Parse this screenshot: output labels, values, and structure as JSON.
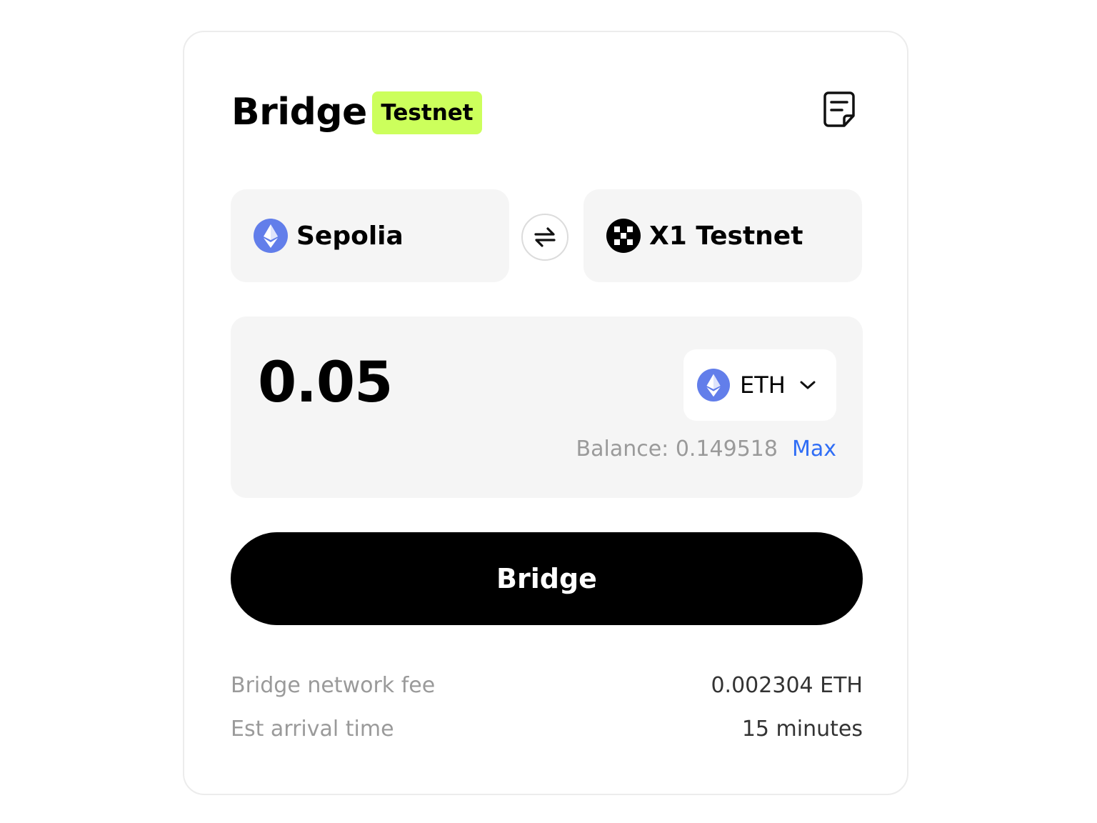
{
  "header": {
    "title": "Bridge",
    "badge": "Testnet",
    "badge_color": "#ccff5c"
  },
  "route": {
    "from": {
      "name": "Sepolia",
      "icon": "ethereum-icon"
    },
    "to": {
      "name": "X1 Testnet",
      "icon": "x1-icon"
    },
    "swap_icon": "swap-arrows-icon"
  },
  "amount": {
    "value": "0.05",
    "token_symbol": "ETH",
    "token_icon": "ethereum-icon",
    "balance_label": "Balance: 0.149518",
    "max_label": "Max"
  },
  "action": {
    "bridge_label": "Bridge"
  },
  "details": {
    "fee_label": "Bridge network fee",
    "fee_value": "0.002304 ETH",
    "time_label": "Est arrival time",
    "time_value": "15 minutes"
  },
  "colors": {
    "eth": "#627eea",
    "link": "#2f6df5",
    "panel": "#f5f5f5"
  }
}
